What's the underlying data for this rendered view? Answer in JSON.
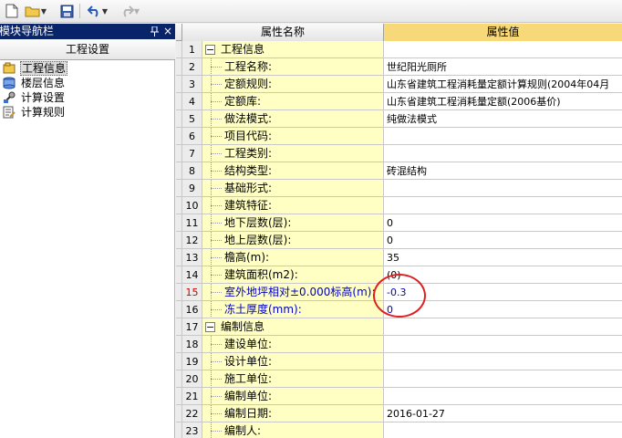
{
  "toolbar": {
    "icons": [
      "new-file-icon",
      "open-folder-icon",
      "save-icon",
      "undo-icon",
      "redo-icon"
    ]
  },
  "nav": {
    "title": "模块导航栏",
    "pin_glyph": "ꟷ",
    "close_glyph": "×",
    "tab": "工程设置",
    "items": [
      {
        "label": "工程信息",
        "icon": "project-info-icon",
        "selected": true
      },
      {
        "label": "楼层信息",
        "icon": "floor-info-icon",
        "selected": false
      },
      {
        "label": "计算设置",
        "icon": "calc-settings-icon",
        "selected": false
      },
      {
        "label": "计算规则",
        "icon": "calc-rules-icon",
        "selected": false
      }
    ]
  },
  "grid": {
    "col_name": "属性名称",
    "col_value": "属性值",
    "rows": [
      {
        "num": "1",
        "name": "工程信息",
        "value": "",
        "group": true
      },
      {
        "num": "2",
        "name": "工程名称:",
        "value": "世纪阳光厕所"
      },
      {
        "num": "3",
        "name": "定额规则:",
        "value": "山东省建筑工程消耗量定额计算规则(2004年04月"
      },
      {
        "num": "4",
        "name": "定额库:",
        "value": "山东省建筑工程消耗量定额(2006基价)"
      },
      {
        "num": "5",
        "name": "做法模式:",
        "value": "纯做法模式"
      },
      {
        "num": "6",
        "name": "项目代码:",
        "value": ""
      },
      {
        "num": "7",
        "name": "工程类别:",
        "value": ""
      },
      {
        "num": "8",
        "name": "结构类型:",
        "value": "砖混结构"
      },
      {
        "num": "9",
        "name": "基础形式:",
        "value": ""
      },
      {
        "num": "10",
        "name": "建筑特征:",
        "value": ""
      },
      {
        "num": "11",
        "name": "地下层数(层):",
        "value": "0"
      },
      {
        "num": "12",
        "name": "地上层数(层):",
        "value": "0"
      },
      {
        "num": "13",
        "name": "檐高(m):",
        "value": "35"
      },
      {
        "num": "14",
        "name": "建筑面积(m2):",
        "value": "(0)"
      },
      {
        "num": "15",
        "name": "室外地坪相对±0.000标高(m):",
        "value": "-0.3",
        "highlight": true
      },
      {
        "num": "16",
        "name": "冻土厚度(mm):",
        "value": "0",
        "blue": true
      },
      {
        "num": "17",
        "name": "编制信息",
        "value": "",
        "group": true
      },
      {
        "num": "18",
        "name": "建设单位:",
        "value": ""
      },
      {
        "num": "19",
        "name": "设计单位:",
        "value": ""
      },
      {
        "num": "20",
        "name": "施工单位:",
        "value": ""
      },
      {
        "num": "21",
        "name": "编制单位:",
        "value": ""
      },
      {
        "num": "22",
        "name": "编制日期:",
        "value": "2016-01-27"
      },
      {
        "num": "23",
        "name": "编制人:",
        "value": ""
      }
    ]
  },
  "colors": {
    "title_bar": "#0a246a",
    "name_cell": "#ffffc4",
    "value_header": "#f7d97a",
    "annotation": "#e02020",
    "highlight_text": "#0000c8"
  }
}
